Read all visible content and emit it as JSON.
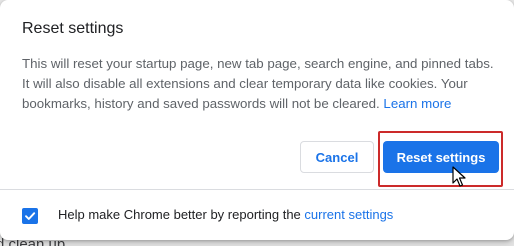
{
  "dialog": {
    "title": "Reset settings",
    "description": "This will reset your startup page, new tab page, search engine, and pinned tabs. It will also disable all extensions and clear temporary data like cookies. Your bookmarks, history and saved passwords will not be cleared.",
    "learn_more": "Learn more",
    "cancel_label": "Cancel",
    "reset_label": "Reset settings",
    "report_text": "Help make Chrome better by reporting the",
    "report_link": "current settings",
    "report_checked": true
  },
  "background": {
    "partial_text": "d clean up"
  },
  "colors": {
    "accent": "#1a73e8",
    "highlight_border": "#cc2a2a"
  },
  "icons": {
    "checkbox": "checkmark-icon",
    "pointer": "mouse-pointer-icon"
  }
}
